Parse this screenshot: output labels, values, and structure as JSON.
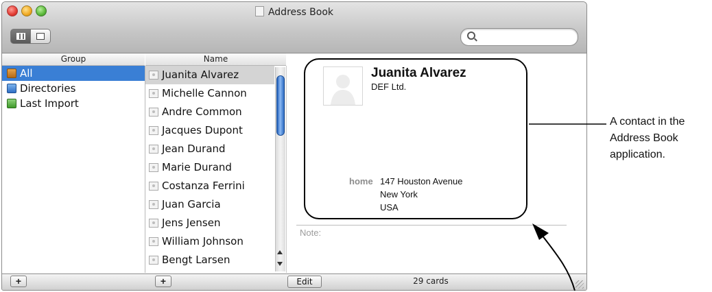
{
  "window": {
    "title": "Address Book"
  },
  "search": {
    "placeholder": ""
  },
  "columns": {
    "group": "Group",
    "name": "Name"
  },
  "groups": [
    {
      "label": "All",
      "icon": "address-book-icon",
      "selected": true
    },
    {
      "label": "Directories",
      "icon": "directory-icon",
      "selected": false
    },
    {
      "label": "Last Import",
      "icon": "import-group-icon",
      "selected": false
    }
  ],
  "names": [
    "Juanita Alvarez",
    "Michelle Cannon",
    "Andre Common",
    "Jacques Dupont",
    "Jean Durand",
    "Marie Durand",
    "Costanza Ferrini",
    "Juan Garcia",
    "Jens Jensen",
    "William Johnson",
    "Bengt Larsen"
  ],
  "selected_name": "Juanita Alvarez",
  "card": {
    "name": "Juanita Alvarez",
    "company": "DEF Ltd.",
    "address_label": "home",
    "address_lines": [
      "147 Houston Avenue",
      "New York",
      "USA"
    ],
    "note_label": "Note:"
  },
  "bottom": {
    "add_label": "+",
    "edit_label": "Edit",
    "count": "29 cards"
  },
  "annotation": {
    "lines": [
      "A contact in the",
      "Address Book",
      "application."
    ]
  },
  "colors": {
    "selection": "#3a7fd5",
    "name_selection": "#d4d4d4",
    "scroll_thumb": "#2d6cc4"
  }
}
